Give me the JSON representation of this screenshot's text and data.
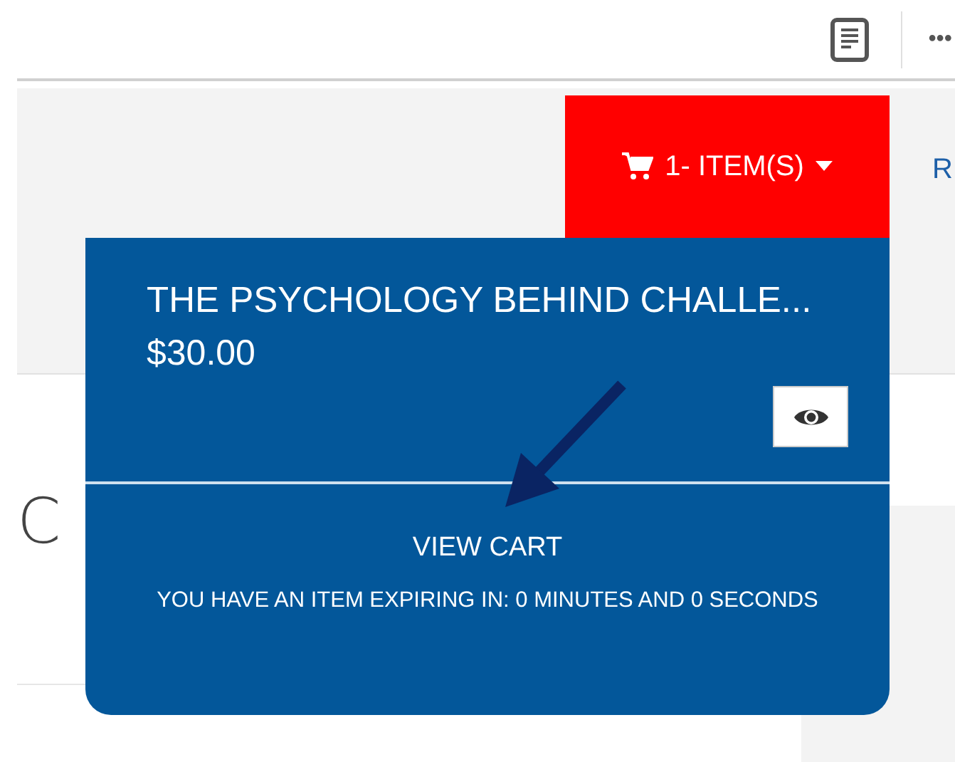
{
  "toolbar": {
    "more": "•••"
  },
  "header": {
    "cart_button": {
      "label": "1- ITEM(S)"
    },
    "next_link": "R"
  },
  "heading": "C",
  "cart_dropdown": {
    "items": [
      {
        "title": "THE PSYCHOLOGY BEHIND CHALLE...",
        "price": "$30.00"
      }
    ],
    "view_cart": "VIEW CART",
    "expiry_note": "YOU HAVE AN ITEM EXPIRING IN: 0 MINUTES AND 0 SECONDS"
  }
}
